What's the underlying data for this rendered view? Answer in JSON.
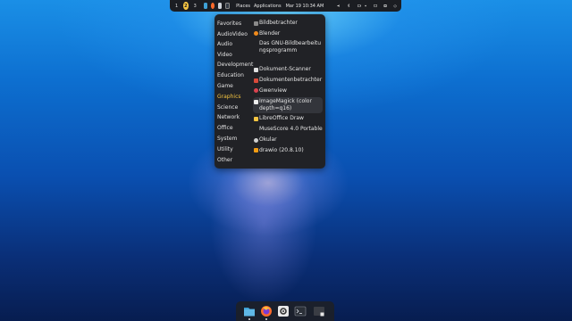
{
  "top_panel": {
    "workspaces": [
      "1",
      "2",
      "3"
    ],
    "active_workspace": "2",
    "apps": [
      {
        "name": "files-icon",
        "color": "#3fa1d6"
      },
      {
        "name": "firefox-icon",
        "color": "#ff6a2b"
      },
      {
        "name": "settings-icon",
        "color": "#cfd3d9"
      },
      {
        "name": "terminal-icon",
        "color": "#333a44"
      }
    ],
    "places_label": "Places",
    "applications_label": "Applications",
    "clock": "Mar 19 10:34 AM"
  },
  "menu": {
    "categories": [
      "Favorites",
      "AudioVideo",
      "Audio",
      "Video",
      "Development",
      "Education",
      "Game",
      "Graphics",
      "Science",
      "Network",
      "Office",
      "System",
      "Utility",
      "Other"
    ],
    "selected_category": "Graphics",
    "items": [
      {
        "label": "Bildbetrachter",
        "icon_color": "#8b8b8b"
      },
      {
        "label": "Blender",
        "icon_color": "#f08a1c"
      },
      {
        "label": "Das GNU-Bildbearbeitungsprogramm",
        "icon_color": "#212226"
      },
      {
        "label": "Dokument-Scanner",
        "icon_color": "#e0e0e0"
      },
      {
        "label": "Dokumentenbetrachter",
        "icon_color": "#d84a3a"
      },
      {
        "label": "Gwenview",
        "icon_color": "#d9434f"
      },
      {
        "label": "ImageMagick (color depth=q16)",
        "icon_color": "#ececec"
      },
      {
        "label": "LibreOffice Draw",
        "icon_color": "#f5c542"
      },
      {
        "label": "MuseScore 4.0 Portable",
        "icon_color": "#212226"
      },
      {
        "label": "Okular",
        "icon_color": "#cfcfcf"
      },
      {
        "label": "drawio (20.8.10)",
        "icon_color": "#f39c12"
      }
    ]
  },
  "dock": {
    "apps": [
      "files-icon",
      "firefox-icon",
      "settings-icon",
      "terminal-icon",
      "app-grid-icon"
    ]
  }
}
